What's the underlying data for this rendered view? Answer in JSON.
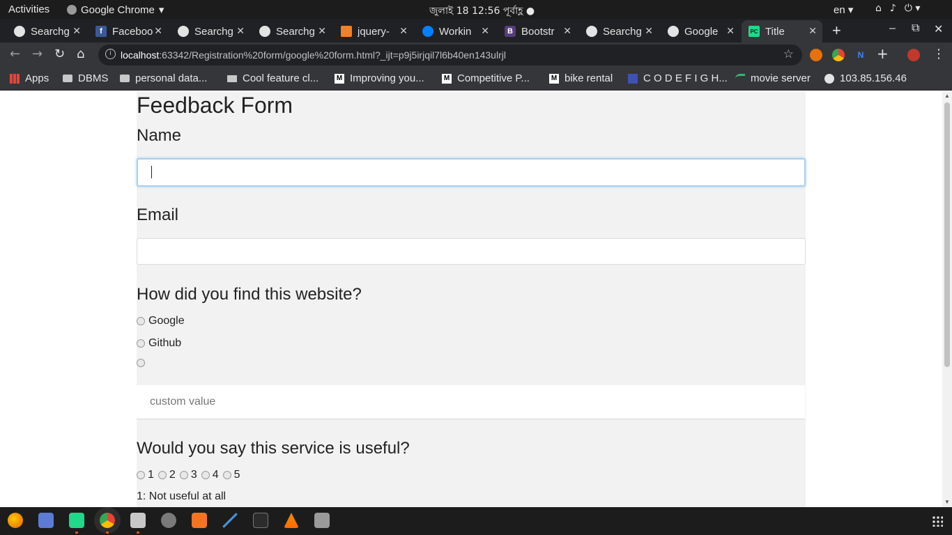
{
  "system_bar": {
    "activities": "Activities",
    "app_name": "Google Chrome",
    "clock": "জুলাই 18  12:56 পূর্বাহ্ণ",
    "language": "en"
  },
  "tabs": [
    {
      "title": "Searchg",
      "favicon": "globe-icon",
      "active": false
    },
    {
      "title": "Faceboo",
      "favicon": "facebook-icon",
      "active": false
    },
    {
      "title": "Searchg",
      "favicon": "globe-icon",
      "active": false
    },
    {
      "title": "Searchg",
      "favicon": "globe-icon",
      "active": false
    },
    {
      "title": "jquery-",
      "favicon": "stackoverflow-icon",
      "active": false
    },
    {
      "title": "Workin",
      "favicon": "digitalocean-icon",
      "active": false
    },
    {
      "title": "Bootstr",
      "favicon": "bootstrap-icon",
      "active": false
    },
    {
      "title": "Searchg",
      "favicon": "globe-icon",
      "active": false
    },
    {
      "title": "Google",
      "favicon": "globe-icon",
      "active": false
    },
    {
      "title": "Title",
      "favicon": "pycharm-icon",
      "active": true
    }
  ],
  "address_bar": {
    "host": "localhost",
    "path": ":63342/Registration%20form/google%20form.html?_ijt=p9j5irjqil7l6b40en143ulrjl"
  },
  "bookmarks": [
    {
      "label": "Apps",
      "icon": "apps-grid-icon"
    },
    {
      "label": "DBMS",
      "icon": "folder-icon"
    },
    {
      "label": "personal data...",
      "icon": "folder-icon"
    },
    {
      "label": "Cool feature cl...",
      "icon": "page-icon"
    },
    {
      "label": "Improving you...",
      "icon": "medium-icon"
    },
    {
      "label": "Competitive P...",
      "icon": "medium-icon"
    },
    {
      "label": "bike rental",
      "icon": "medium-icon"
    },
    {
      "label": "C O D E F I G H...",
      "icon": "codefights-icon"
    },
    {
      "label": "movie server",
      "icon": "leaf-icon"
    },
    {
      "label": "103.85.156.46",
      "icon": "globe-icon"
    }
  ],
  "form": {
    "title": "Feedback Form",
    "name_label": "Name",
    "email_label": "Email",
    "source_question": "How did you find this website?",
    "source_options": [
      "Google",
      "Github",
      ""
    ],
    "custom_placeholder": "custom value",
    "useful_question": "Would you say this service is useful?",
    "scale": [
      "1",
      "2",
      "3",
      "4",
      "5"
    ],
    "scale_note": "1: Not useful at all"
  },
  "dock_apps": [
    "firefox-icon",
    "screenshot-icon",
    "pycharm-icon",
    "chrome-icon",
    "files-icon",
    "search-icon",
    "software-center-icon",
    "pen-icon",
    "terminal-icon",
    "vlc-icon",
    "image-viewer-icon"
  ],
  "colors": {
    "accent": "#a8d0f0",
    "form_background": "#f2f2f2",
    "chrome_dark": "#35363a"
  }
}
